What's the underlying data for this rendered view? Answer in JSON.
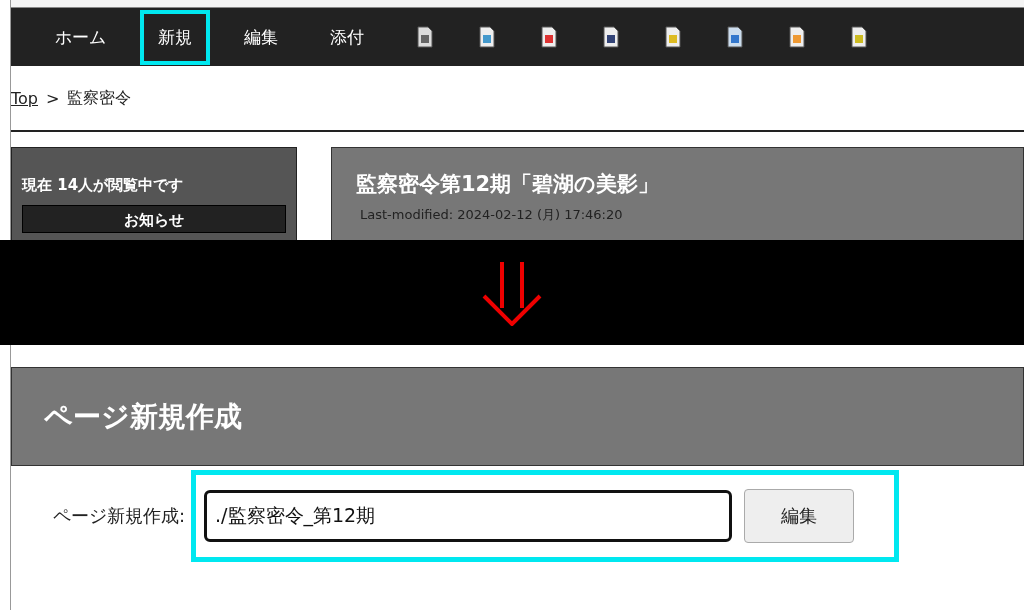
{
  "nav": {
    "items": [
      {
        "label": "ホーム",
        "highlighted": false
      },
      {
        "label": "新規",
        "highlighted": true
      },
      {
        "label": "編集",
        "highlighted": false
      },
      {
        "label": "添付",
        "highlighted": false
      }
    ]
  },
  "breadcrumb": {
    "link": "Top",
    "separator": ">",
    "current": "監察密令"
  },
  "sidebar": {
    "visitors": "現在 14人が閲覧中です",
    "box_title": "お知らせ"
  },
  "page_header": {
    "title": "監察密令第12期「碧湖の美影」",
    "last_modified": "Last-modified: 2024-02-12 (月) 17:46:20"
  },
  "new_page": {
    "heading": "ページ新規作成",
    "label": "ページ新規作成:",
    "value": "./監察密令_第12期",
    "button": "編集",
    "highlighted": true
  }
}
